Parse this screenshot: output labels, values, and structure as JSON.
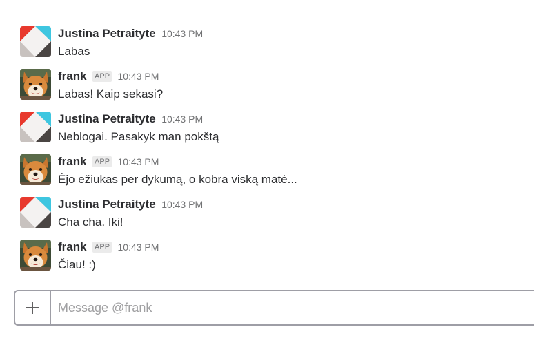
{
  "messages": [
    {
      "sender": "Justina Petraityte",
      "is_app": false,
      "app_badge": "",
      "time": "10:43 PM",
      "text": "Labas",
      "avatar": "justina-avatar"
    },
    {
      "sender": "frank",
      "is_app": true,
      "app_badge": "APP",
      "time": "10:43 PM",
      "text": "Labas! Kaip sekasi?",
      "avatar": "frank-avatar"
    },
    {
      "sender": "Justina Petraityte",
      "is_app": false,
      "app_badge": "",
      "time": "10:43 PM",
      "text": "Neblogai. Pasakyk man pokštą",
      "avatar": "justina-avatar"
    },
    {
      "sender": "frank",
      "is_app": true,
      "app_badge": "APP",
      "time": "10:43 PM",
      "text": "Ėjo ežiukas per dykumą, o kobra viską matė...",
      "avatar": "frank-avatar"
    },
    {
      "sender": "Justina Petraityte",
      "is_app": false,
      "app_badge": "",
      "time": "10:43 PM",
      "text": "Cha cha. Iki!",
      "avatar": "justina-avatar"
    },
    {
      "sender": "frank",
      "is_app": true,
      "app_badge": "APP",
      "time": "10:43 PM",
      "text": "Čiau! :)",
      "avatar": "frank-avatar"
    }
  ],
  "composer": {
    "placeholder": "Message @frank",
    "value": "",
    "plus_icon": "plus-icon"
  },
  "colors": {
    "text": "#2c2d30",
    "muted": "#717274",
    "border": "#9e9ea6",
    "justina_red": "#e8392d",
    "justina_cyan": "#3ec6e0",
    "justina_dark": "#4a4543",
    "justina_gray": "#c8c2bf"
  }
}
